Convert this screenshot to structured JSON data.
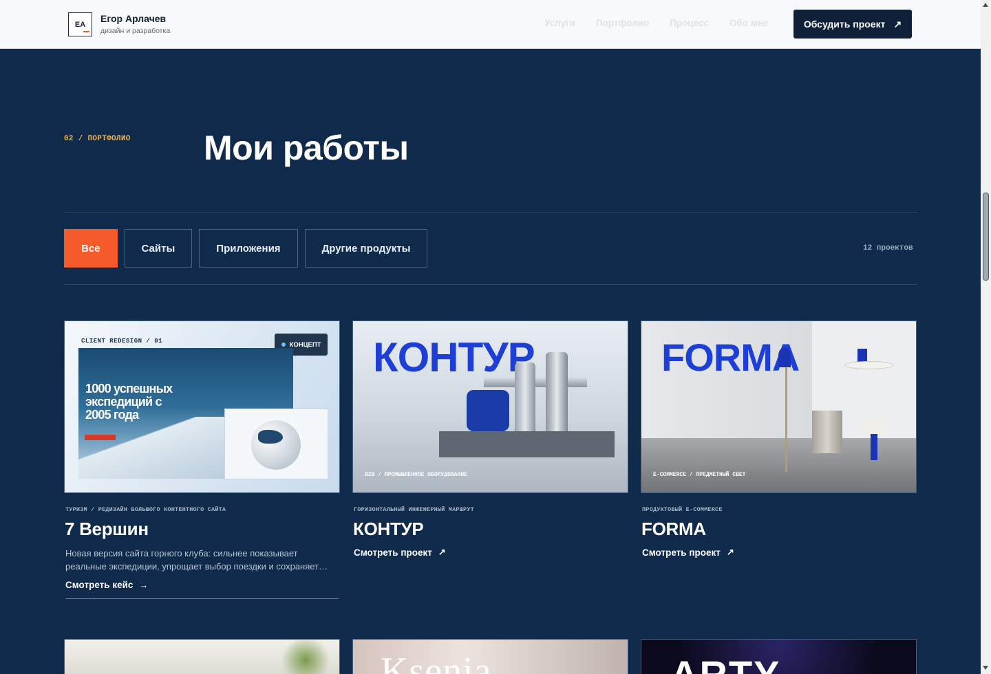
{
  "header": {
    "logo_initials": "EA",
    "brand_name": "Егор Арлачев",
    "brand_sub": "дизайн и разработка",
    "nav": [
      "Услуги",
      "Портфолио",
      "Процесс",
      "Обо мне"
    ],
    "cta_label": "Обсудить проект",
    "cta_icon": "arrow-up-right-icon"
  },
  "section": {
    "eyebrow": "02 / ПОРТФОЛИО",
    "title": "Мои работы"
  },
  "filters": {
    "items": [
      "Все",
      "Сайты",
      "Приложения",
      "Другие продукты"
    ],
    "active": "Все",
    "count": "12 проектов"
  },
  "cards": [
    {
      "thumb_label": "CLIENT REDESIGN / 01",
      "thumb_badge": "КОНЦЕПТ",
      "thumb_hero_text": "1000 успешных экспедиций с 2005 года",
      "meta": "ТУРИЗМ / РЕДИЗАЙН БОЛЬШОГО КОНТЕНТНОГО САЙТА",
      "title": "7 Вершин",
      "description": "Новая версия сайта горного клуба: сильнее показывает реальные экспедиции, упрощает выбор поездки и сохраняет…",
      "link": "Смотреть кейс"
    },
    {
      "thumb_big": "КОНТУР",
      "thumb_caption": "B2B / ПРОМЫШЛЕННОЕ ОБОРУДОВАНИЕ",
      "meta": "ГОРИЗОНТАЛЬНЫЙ ИНЖЕНЕРНЫЙ МАРШРУТ",
      "title": "КОНТУР",
      "link": "Смотреть проект"
    },
    {
      "thumb_big": "FORMA",
      "thumb_caption": "E-COMMERCE / ПРЕДМЕТНЫЙ СВЕТ",
      "meta": "ПРОДУКТОВЫЙ E-COMMERCE",
      "title": "FORMA",
      "link": "Смотреть проект"
    }
  ],
  "row2": {
    "second_word": "Ksenia",
    "third_word": "ARTY"
  },
  "colors": {
    "page_bg": "#0f2a4b",
    "accent": "#f45a2a",
    "eyebrow": "#f2b34a",
    "brand_blue": "#1d3fd6"
  }
}
